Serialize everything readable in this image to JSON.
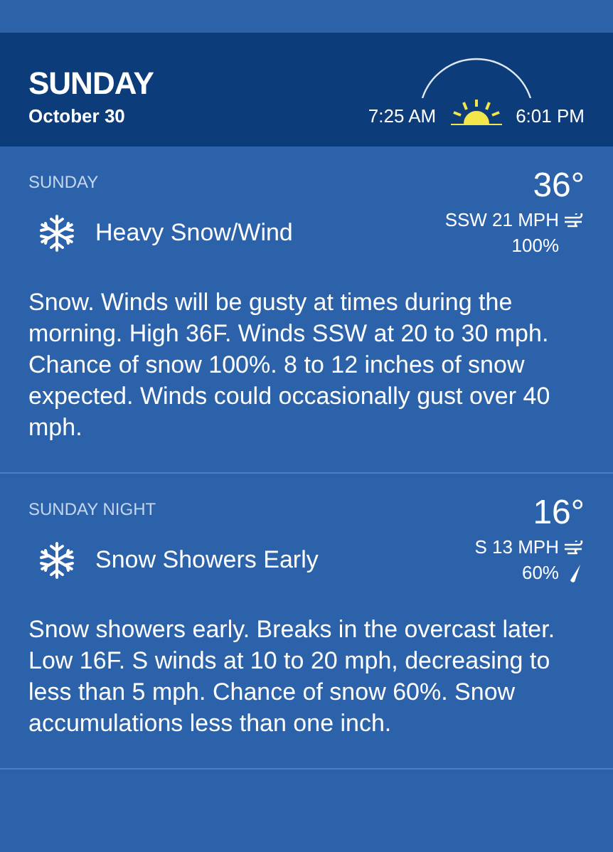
{
  "header": {
    "day": "SUNDAY",
    "date": "October 30",
    "sunrise": "7:25 AM",
    "sunset": "6:01 PM"
  },
  "periods": [
    {
      "name": "SUNDAY",
      "temp": "36°",
      "condition": "Heavy Snow/Wind",
      "wind": "SSW 21 MPH",
      "precip": "100%",
      "drop_icon": false,
      "description": "Snow. Winds will be gusty at times during the morning. High 36F. Winds SSW at 20 to 30 mph. Chance of snow 100%. 8 to 12 inches of snow expected. Winds could occasionally gust over 40 mph."
    },
    {
      "name": "SUNDAY NIGHT",
      "temp": "16°",
      "condition": "Snow Showers Early",
      "wind": "S 13 MPH",
      "precip": "60%",
      "drop_icon": true,
      "description": "Snow showers early. Breaks in the overcast later. Low 16F. S winds at 10 to 20 mph, decreasing to less than 5 mph. Chance of snow 60%. Snow accumulations less than one inch."
    }
  ]
}
